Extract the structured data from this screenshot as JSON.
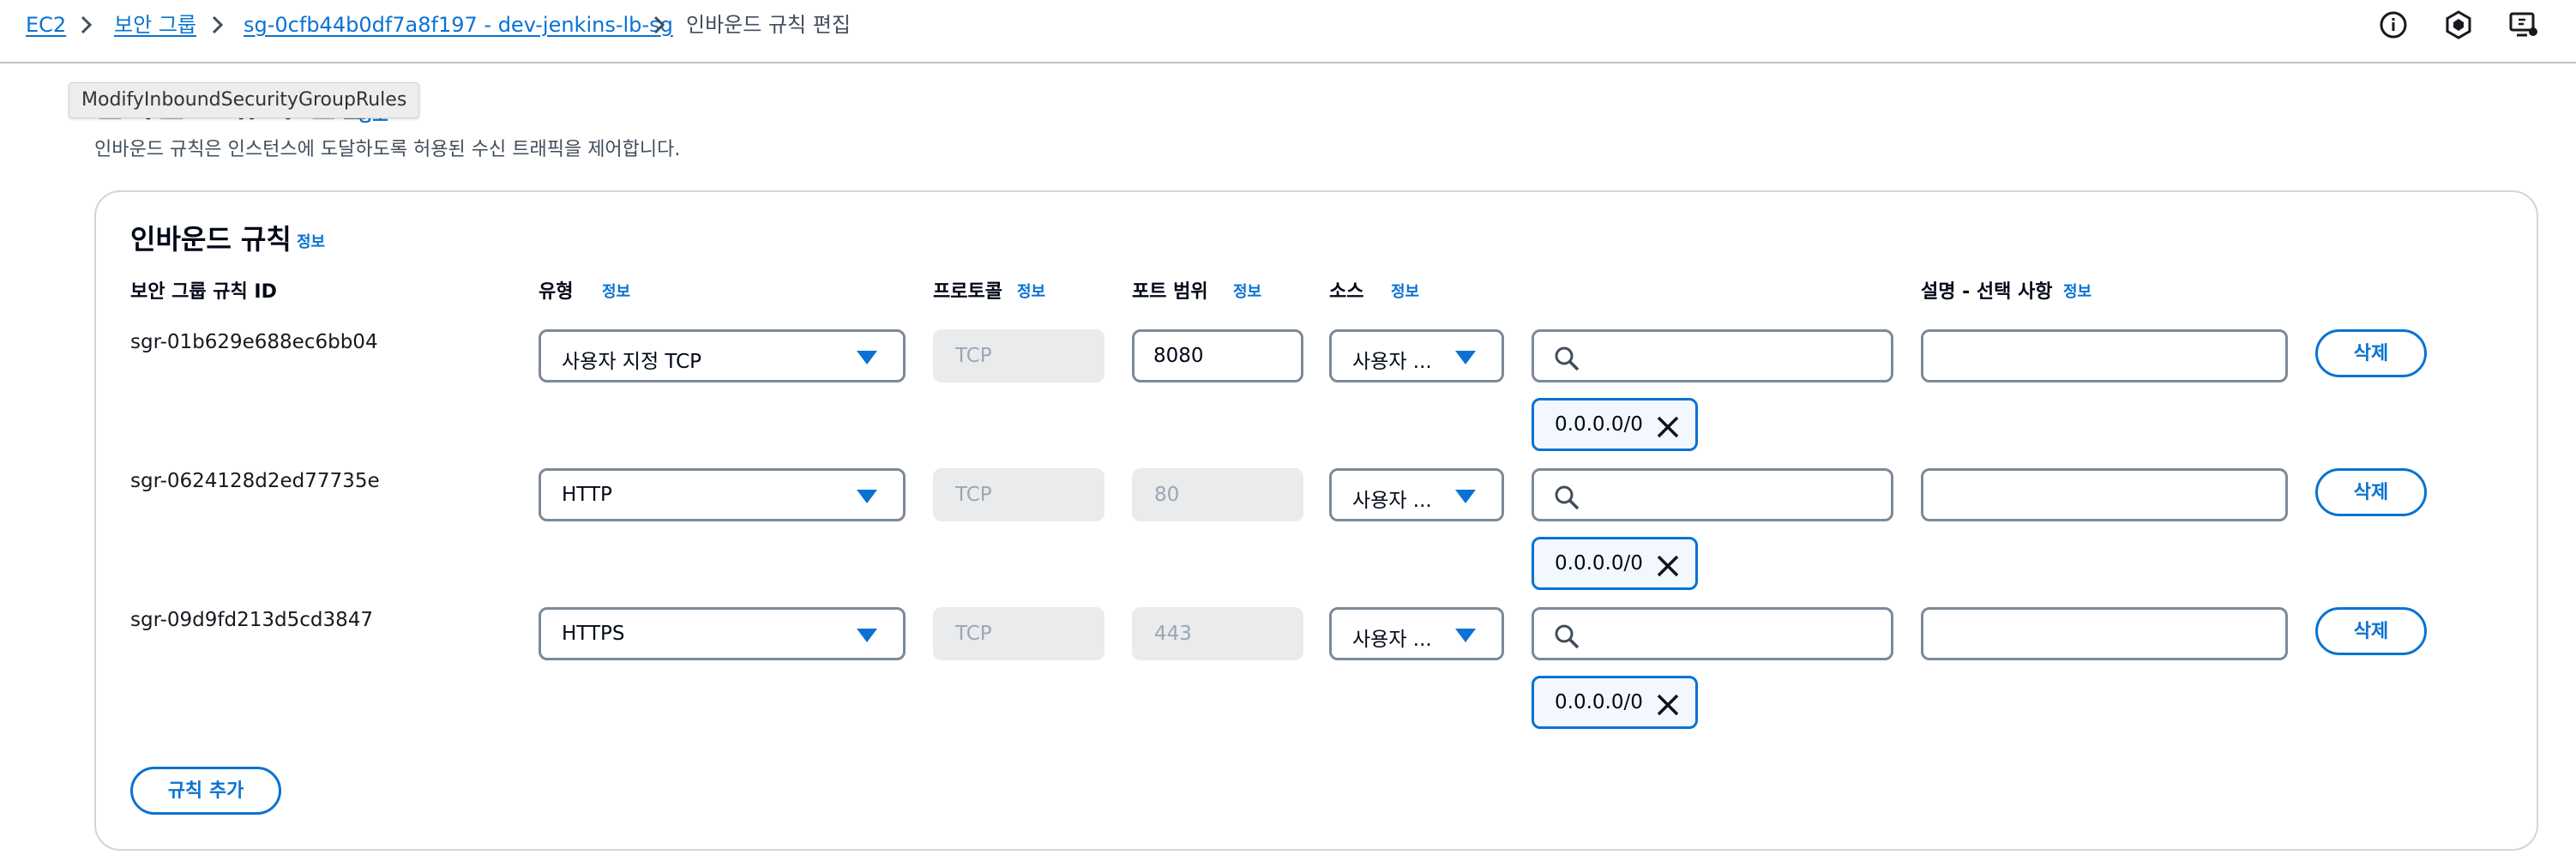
{
  "breadcrumb": {
    "items": [
      {
        "label": "EC2"
      },
      {
        "label": "보안 그룹"
      },
      {
        "label": "sg-0cfb44b0df7a8f197 - dev-jenkins-lb-sg"
      },
      {
        "label": "인바운드 규칙 편집"
      }
    ]
  },
  "top_icons": [
    "info-icon",
    "settings-hex-icon",
    "feedback-screen-icon"
  ],
  "tooltip": "ModifyInboundSecurityGroupRules",
  "page": {
    "title": "인바운드 규칙 편집",
    "title_info": "정보",
    "description": "인바운드 규칙은 인스턴스에 도달하도록 허용된 수신 트래픽을 제어합니다."
  },
  "panel": {
    "title": "인바운드 규칙",
    "title_info": "정보",
    "columns": {
      "rule_id": "보안 그룹 규칙 ID",
      "type": "유형",
      "protocol": "프로토콜",
      "port_range": "포트 범위",
      "source": "소스",
      "description": "설명 - 선택 사항"
    },
    "info_label": "정보",
    "rules": [
      {
        "id": "sgr-01b629e688ec6bb04",
        "type": "사용자 지정 TCP",
        "protocol": "TCP",
        "port": "8080",
        "source": "사용자 ...",
        "cidr": "0.0.0.0/0",
        "description": "",
        "delete": "삭제"
      },
      {
        "id": "sgr-0624128d2ed77735e",
        "type": "HTTP",
        "protocol": "TCP",
        "port": "80",
        "source": "사용자 ...",
        "cidr": "0.0.0.0/0",
        "description": "",
        "delete": "삭제"
      },
      {
        "id": "sgr-09d9fd213d5cd3847",
        "type": "HTTPS",
        "protocol": "TCP",
        "port": "443",
        "source": "사용자 ...",
        "cidr": "0.0.0.0/0",
        "description": "",
        "delete": "삭제"
      }
    ],
    "add_rule": "규칙 추가"
  },
  "colors": {
    "link": "#0972d3",
    "border": "#7d8998",
    "disabled_bg": "#e9ebed"
  }
}
